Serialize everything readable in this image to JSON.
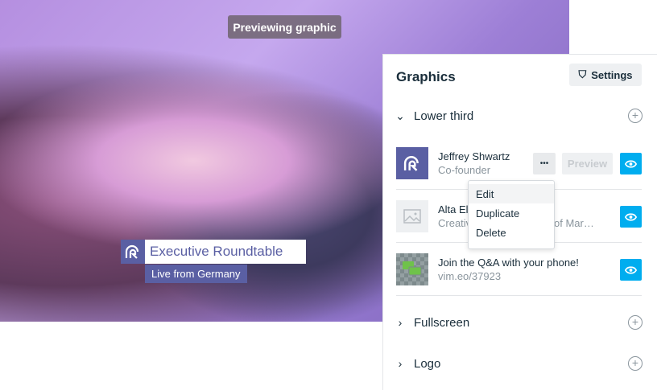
{
  "preview_badge": "Previewing graphic",
  "lower_third_overlay": {
    "title": "Executive Roundtable",
    "subtitle": "Live from Germany"
  },
  "panel": {
    "title": "Graphics",
    "settings_label": "Settings",
    "sections": [
      {
        "label": "Lower third",
        "expanded": true
      },
      {
        "label": "Fullscreen",
        "expanded": false
      },
      {
        "label": "Logo",
        "expanded": false
      }
    ],
    "items": [
      {
        "title": "Jeffrey Shwartz",
        "subtitle": "Co-founder",
        "more": "•••",
        "preview": "Preview"
      },
      {
        "title": "Alta Elli",
        "subtitle": "Creativ",
        "subtitle_tail": "of Mar…"
      },
      {
        "title": "Join the Q&A with your phone!",
        "subtitle": "vim.eo/37923"
      }
    ],
    "menu": [
      "Edit",
      "Duplicate",
      "Delete"
    ]
  },
  "colors": {
    "accent": "#00adef",
    "brand": "#5a5fa3"
  }
}
